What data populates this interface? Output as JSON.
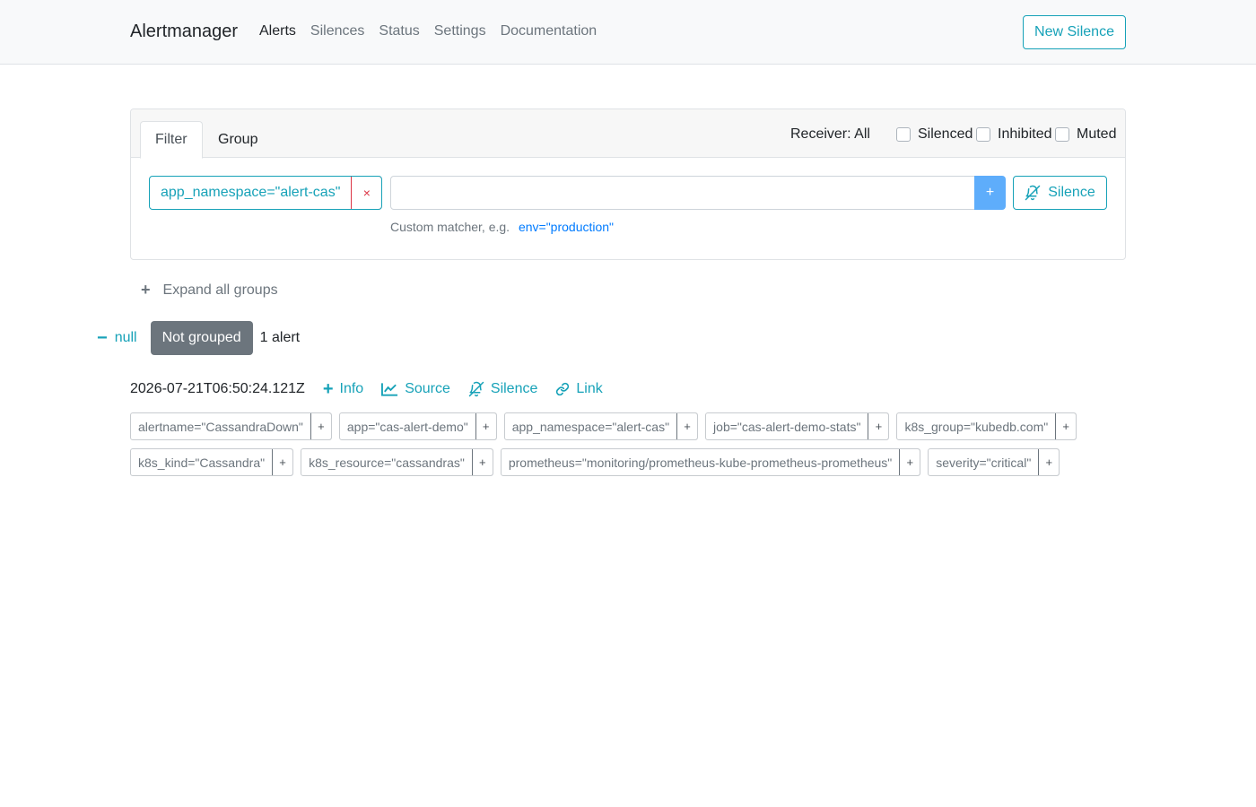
{
  "navbar": {
    "brand": "Alertmanager",
    "items": [
      {
        "label": "Alerts",
        "active": true
      },
      {
        "label": "Silences",
        "active": false
      },
      {
        "label": "Status",
        "active": false
      },
      {
        "label": "Settings",
        "active": false
      },
      {
        "label": "Documentation",
        "active": false
      }
    ],
    "new_silence": "New Silence"
  },
  "filter": {
    "tabs": [
      "Filter",
      "Group"
    ],
    "receiver": "Receiver: All",
    "checkboxes": [
      "Silenced",
      "Inhibited",
      "Muted"
    ],
    "matcher": "app_namespace=\"alert-cas\"",
    "matcher_remove": "×",
    "input_value": "",
    "add": "+",
    "silence": "Silence",
    "hint": "Custom matcher, e.g.",
    "hint_example": "env=\"production\""
  },
  "expand": {
    "icon": "+",
    "label": "Expand all groups"
  },
  "group": {
    "collapse_icon": "−",
    "name": "null",
    "badge": "Not grouped",
    "count": "1 alert"
  },
  "alert": {
    "timestamp": "2026-07-21T06:50:24.121Z",
    "actions": {
      "info": "Info",
      "source": "Source",
      "silence": "Silence",
      "link": "Link"
    },
    "info_icon": "+",
    "labels": [
      "alertname=\"CassandraDown\"",
      "app=\"cas-alert-demo\"",
      "app_namespace=\"alert-cas\"",
      "job=\"cas-alert-demo-stats\"",
      "k8s_group=\"kubedb.com\"",
      "k8s_kind=\"Cassandra\"",
      "k8s_resource=\"cassandras\"",
      "prometheus=\"monitoring/prometheus-kube-prometheus-prometheus\"",
      "severity=\"critical\""
    ],
    "label_add": "+"
  },
  "colors": {
    "accent": "#17a2b8",
    "danger": "#dc3545",
    "secondary": "#6c757d",
    "primary_light": "#5eadfb"
  }
}
